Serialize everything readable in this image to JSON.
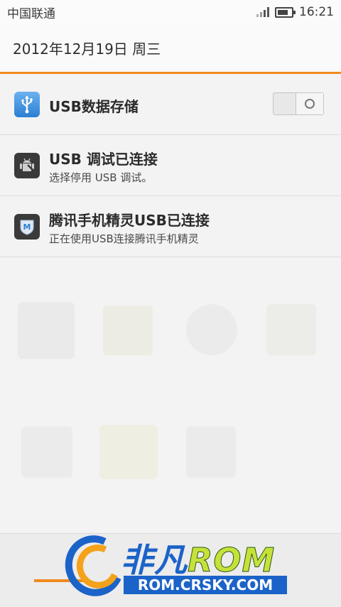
{
  "status_bar": {
    "carrier": "中国联通",
    "time": "16:21"
  },
  "header": {
    "date": "2012年12月19日 周三"
  },
  "notifications": [
    {
      "title": "USB数据存储",
      "subtitle": "",
      "toggle_on": false,
      "icon": "usb-icon"
    },
    {
      "title": "USB 调试已连接",
      "subtitle": "选择停用 USB 调试。",
      "icon": "android-debug-icon"
    },
    {
      "title": "腾讯手机精灵USB已连接",
      "subtitle": "正在使用USB连接腾讯手机精灵",
      "icon": "tencent-manager-icon"
    }
  ],
  "watermark": {
    "brand_cn": "非凡",
    "brand_rom": "ROM",
    "url": "ROM.CRSKY.COM"
  },
  "colors": {
    "accent": "#f08a1c",
    "brand_blue": "#1b63c8",
    "brand_green": "#c6e23a"
  }
}
